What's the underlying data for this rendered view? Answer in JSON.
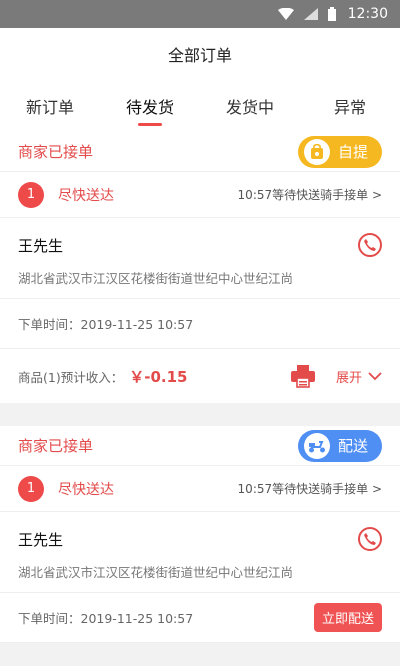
{
  "statusbar": {
    "time": "12:30"
  },
  "header": {
    "title": "全部订单"
  },
  "tabs": [
    {
      "label": "新订单"
    },
    {
      "label": "待发货"
    },
    {
      "label": "发货中"
    },
    {
      "label": "异常"
    }
  ],
  "orders": [
    {
      "status": "商家已接单",
      "mode_label": "自提",
      "mode_icon": "bag-icon",
      "mode_color": "#f6b820",
      "seq": "1",
      "urgent": "尽快送达",
      "wait_text": "10:57等待快送骑手接单 >",
      "customer": "王先生",
      "address": "湖北省武汉市江汉区花楼街街道世纪中心世纪江尚",
      "order_time": "下单时间：2019-11-25 10:57",
      "income_label": "商品(1)预计收入：",
      "income_value": "￥-0.15",
      "expand_label": "展开"
    },
    {
      "status": "商家已接单",
      "mode_label": "配送",
      "mode_icon": "scooter-icon",
      "mode_color": "#4f8ff4",
      "seq": "1",
      "urgent": "尽快送达",
      "wait_text": "10:57等待快送骑手接单 >",
      "customer": "王先生",
      "address": "湖北省武汉市江汉区花楼街街道世纪中心世纪江尚",
      "order_time": "下单时间：2019-11-25 10:57",
      "deliver_label": "立即配送"
    }
  ],
  "colors": {
    "accent": "#e34b4b",
    "statusbar": "#7a7a7a"
  }
}
